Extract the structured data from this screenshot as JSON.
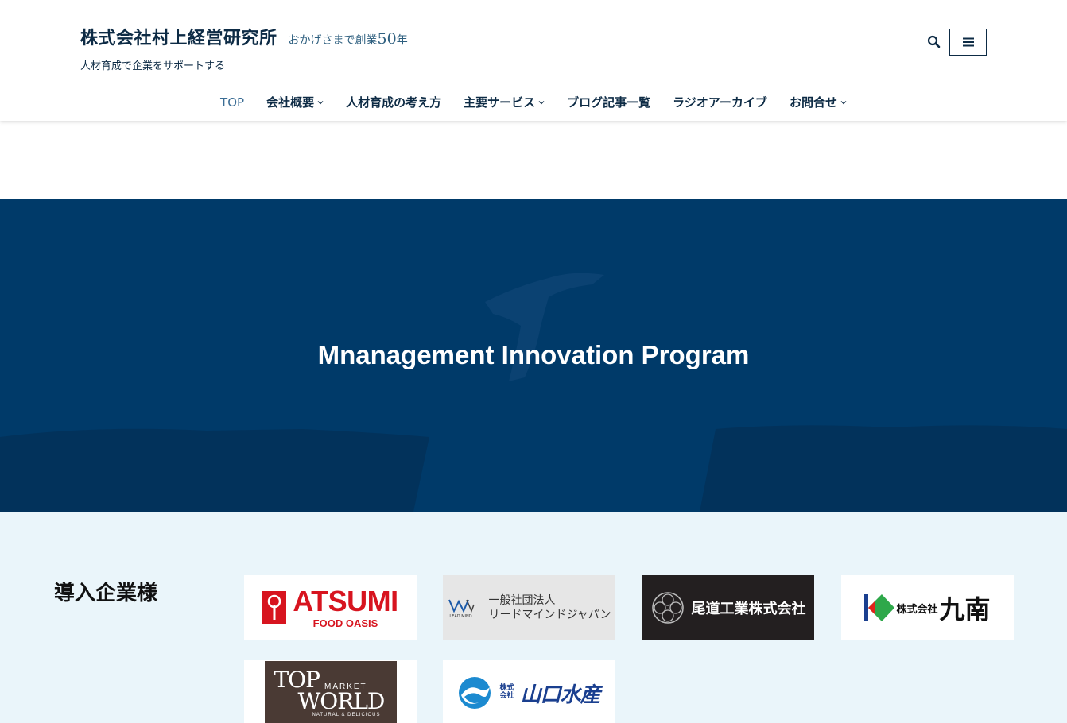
{
  "header": {
    "site_title": "株式会社村上経営研究所",
    "catch_prefix": "おかげさまで創業",
    "catch_number": "50",
    "catch_suffix": "年",
    "tagline": "人材育成で企業をサポートする"
  },
  "nav": {
    "items": [
      {
        "label": "TOP"
      },
      {
        "label": "会社概要"
      },
      {
        "label": "人材育成の考え方"
      },
      {
        "label": "主要サービス"
      },
      {
        "label": "ブログ記事一覧"
      },
      {
        "label": "ラジオアーカイブ"
      },
      {
        "label": "お問合せ"
      }
    ]
  },
  "hero": {
    "title": "Mnanagement Innovation Program"
  },
  "clients": {
    "heading": "導入企業様",
    "logos": {
      "atsumi_name": "ATSUMI",
      "atsumi_sub": "FOOD OASIS",
      "leadmind_line1": "一般社団法人",
      "leadmind_line2": "リードマインドジャパン",
      "leadmind_mark": "LEAD MIND",
      "onomichi": "尾道工業株式会社",
      "kunan_small": "株式会社",
      "kunan_big": "九南",
      "tw_top": "TOP",
      "tw_market": "MARKET",
      "tw_world": "WORLD",
      "tw_tag": "NATURAL & DELICIOUS",
      "ym_small1": "株式",
      "ym_small2": "会社",
      "ym_big": "山口水産"
    }
  },
  "colors": {
    "brand_navy": "#0d2b45",
    "hero_blue": "#003a69",
    "clients_bg": "#eaf5fa"
  }
}
